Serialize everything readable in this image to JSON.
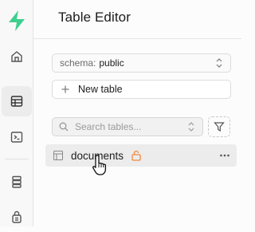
{
  "rail": {
    "logo": "supabase-logo",
    "items": [
      {
        "icon": "home-icon",
        "active": false
      },
      {
        "icon": "table-editor-icon",
        "active": true
      },
      {
        "icon": "sql-editor-icon",
        "active": false
      },
      {
        "icon": "database-icon",
        "active": false
      },
      {
        "icon": "auth-lock-icon",
        "active": false
      }
    ]
  },
  "header": {
    "title": "Table Editor"
  },
  "schema": {
    "label": "schema:",
    "value": "public"
  },
  "new_table": {
    "label": "New table"
  },
  "search": {
    "placeholder": "Search tables..."
  },
  "tables": [
    {
      "name": "documents",
      "locked": true
    }
  ],
  "colors": {
    "lock": "#f0883e",
    "brand": "#3ecf8e"
  }
}
